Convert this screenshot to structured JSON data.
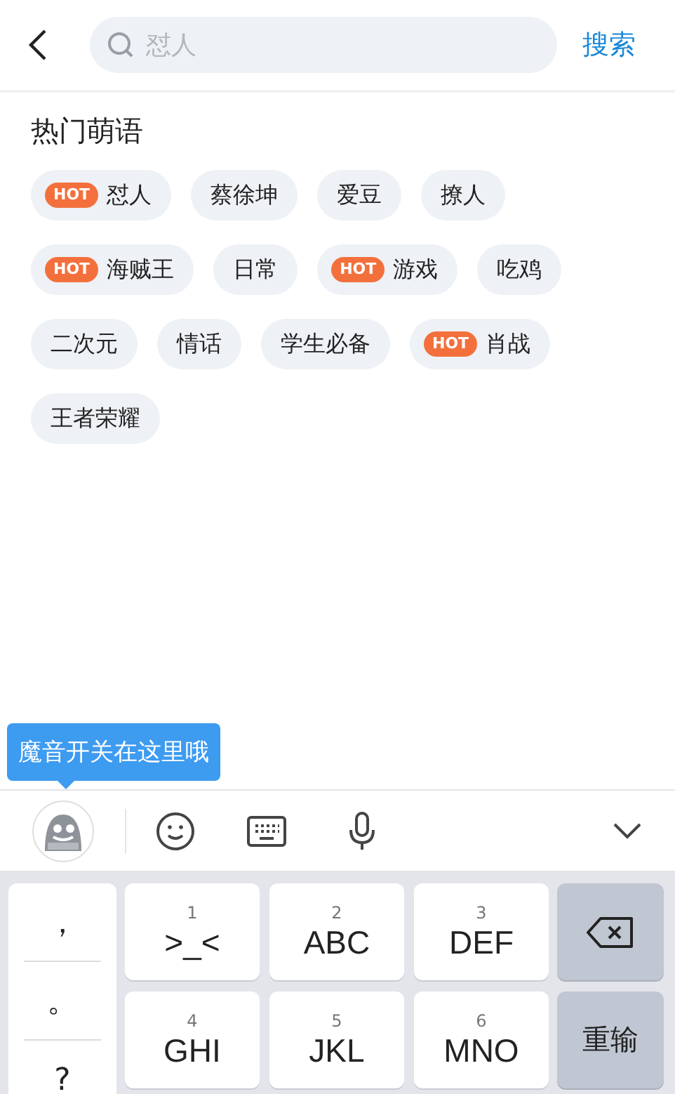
{
  "header": {
    "search_placeholder": "怼人",
    "search_button": "搜索"
  },
  "section_title": "热门萌语",
  "tag_rows": [
    [
      {
        "label": "怼人",
        "badge": "HOT"
      },
      {
        "label": "蔡徐坤"
      },
      {
        "label": "爱豆"
      },
      {
        "label": "撩人"
      }
    ],
    [
      {
        "label": "海贼王",
        "badge": "HOT"
      },
      {
        "label": "日常"
      },
      {
        "label": "游戏",
        "badge": "HOT"
      },
      {
        "label": "吃鸡"
      }
    ],
    [
      {
        "label": "二次元"
      },
      {
        "label": "情话"
      },
      {
        "label": "学生必备"
      },
      {
        "label": "肖战",
        "badge": "HOT"
      }
    ],
    [
      {
        "label": "王者荣耀"
      }
    ]
  ],
  "tooltip": "魔音开关在这里哦",
  "keyboard": {
    "punctuation": [
      "，",
      "。",
      "?"
    ],
    "keys": [
      {
        "digit": "1",
        "letters": ">_<"
      },
      {
        "digit": "2",
        "letters": "ABC"
      },
      {
        "digit": "3",
        "letters": "DEF"
      },
      {
        "digit": "4",
        "letters": "GHI"
      },
      {
        "digit": "5",
        "letters": "JKL"
      },
      {
        "digit": "6",
        "letters": "MNO"
      }
    ],
    "reset": "重输"
  }
}
